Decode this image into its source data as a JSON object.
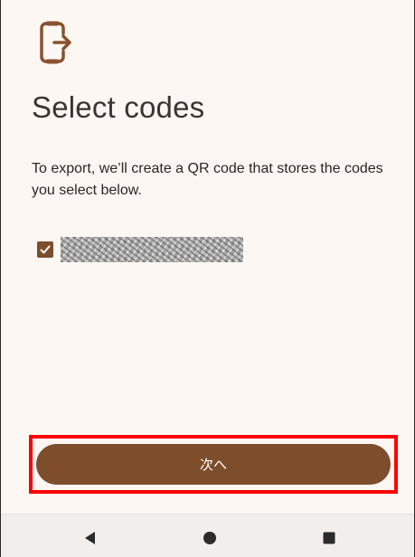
{
  "screen": {
    "title": "Select codes",
    "description": "To export, we’ll create a QR code that stores the codes you select below.",
    "header_icon": "export-phone-icon"
  },
  "codes": [
    {
      "label": "",
      "checked": true,
      "redacted": true
    }
  ],
  "actions": {
    "next_label": "次へ",
    "next_highlighted": true
  },
  "system_nav": {
    "back_icon": "back-triangle-icon",
    "home_icon": "home-circle-icon",
    "recents_icon": "recents-square-icon"
  },
  "colors": {
    "accent": "#7d4d2c",
    "background": "#fdf7f4",
    "title_text": "#3b3431",
    "body_text": "#2d2522",
    "highlight": "#ff0000",
    "nav_bar": "#f2eeec"
  }
}
